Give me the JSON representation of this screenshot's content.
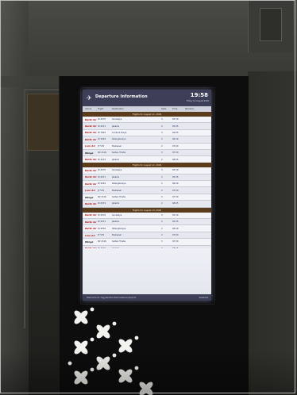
{
  "screen": {
    "header": {
      "title": "Departure Information",
      "time": "19:58",
      "date": "Friday 10 August 2018"
    },
    "columns": {
      "airline": "Airline",
      "flight": "Flight",
      "destination": "Destination",
      "gate": "Gate",
      "time": "Time",
      "remarks": "Remarks"
    },
    "sections": [
      {
        "heading": "Flights for August 11, 2018",
        "rows": [
          {
            "airline": "Batik Air",
            "flight": "ID 6370",
            "destination": "Surabaya",
            "gate": "3",
            "time": "05:30"
          },
          {
            "airline": "Batik Air",
            "flight": "ID 6371",
            "destination": "Jakarta",
            "gate": "2",
            "time": "05:45"
          },
          {
            "airline": "Batik Air",
            "flight": "ID 7801",
            "destination": "Lombok Praya",
            "gate": "3",
            "time": "06:05"
          },
          {
            "airline": "Batik Air",
            "flight": "ID 6316",
            "destination": "Palangkaraya",
            "gate": "2",
            "time": "06:40"
          },
          {
            "airline": "Lion Air",
            "flight": "JT 576",
            "destination": "Makassar",
            "gate": "2",
            "time": "07:00"
          },
          {
            "airline": "Wings",
            "flight": "IW 1316",
            "destination": "Sultan Thaha",
            "gate": "3",
            "time": "07:30"
          },
          {
            "airline": "Batik Air",
            "flight": "ID 6374",
            "destination": "Jakarta",
            "gate": "2",
            "time": "08:05"
          }
        ]
      },
      {
        "heading": "Flights for August 12, 2018",
        "rows": [
          {
            "airline": "Batik Air",
            "flight": "ID 6370",
            "destination": "Surabaya",
            "gate": "3",
            "time": "05:30"
          },
          {
            "airline": "Batik Air",
            "flight": "ID 6371",
            "destination": "Jakarta",
            "gate": "2",
            "time": "05:45"
          },
          {
            "airline": "Batik Air",
            "flight": "ID 6316",
            "destination": "Palangkaraya",
            "gate": "2",
            "time": "06:40"
          },
          {
            "airline": "Lion Air",
            "flight": "JT 576",
            "destination": "Makassar",
            "gate": "2",
            "time": "07:00"
          },
          {
            "airline": "Wings",
            "flight": "IW 1316",
            "destination": "Sultan Thaha",
            "gate": "3",
            "time": "07:30"
          },
          {
            "airline": "Batik Air",
            "flight": "ID 6374",
            "destination": "Jakarta",
            "gate": "2",
            "time": "08:05"
          }
        ]
      },
      {
        "heading": "Flights for August 13, 2018",
        "rows": [
          {
            "airline": "Batik Air",
            "flight": "ID 6370",
            "destination": "Surabaya",
            "gate": "3",
            "time": "05:30"
          },
          {
            "airline": "Batik Air",
            "flight": "ID 6371",
            "destination": "Jakarta",
            "gate": "2",
            "time": "05:45"
          },
          {
            "airline": "Batik Air",
            "flight": "ID 6316",
            "destination": "Palangkaraya",
            "gate": "2",
            "time": "06:40"
          },
          {
            "airline": "Lion Air",
            "flight": "JT 576",
            "destination": "Makassar",
            "gate": "2",
            "time": "07:00"
          },
          {
            "airline": "Wings",
            "flight": "IW 1316",
            "destination": "Sultan Thaha",
            "gate": "3",
            "time": "07:30"
          },
          {
            "airline": "Batik Air",
            "flight": "ID 6374",
            "destination": "Jakarta",
            "gate": "2",
            "time": "08:05"
          }
        ]
      }
    ],
    "footer": {
      "welcome": "Welcome to Yogyakarta International Airport",
      "goodbye": "Selamat"
    }
  },
  "colors": {
    "header_bar": "#3c3f57",
    "section_bar": "#5a3b1c",
    "screen_bg": "#e9ebf2",
    "kiosk": "#0d0d0e",
    "batik_red": "#b4161b"
  },
  "icons": [
    "airplane-icon",
    "flower-pattern-decoration"
  ]
}
